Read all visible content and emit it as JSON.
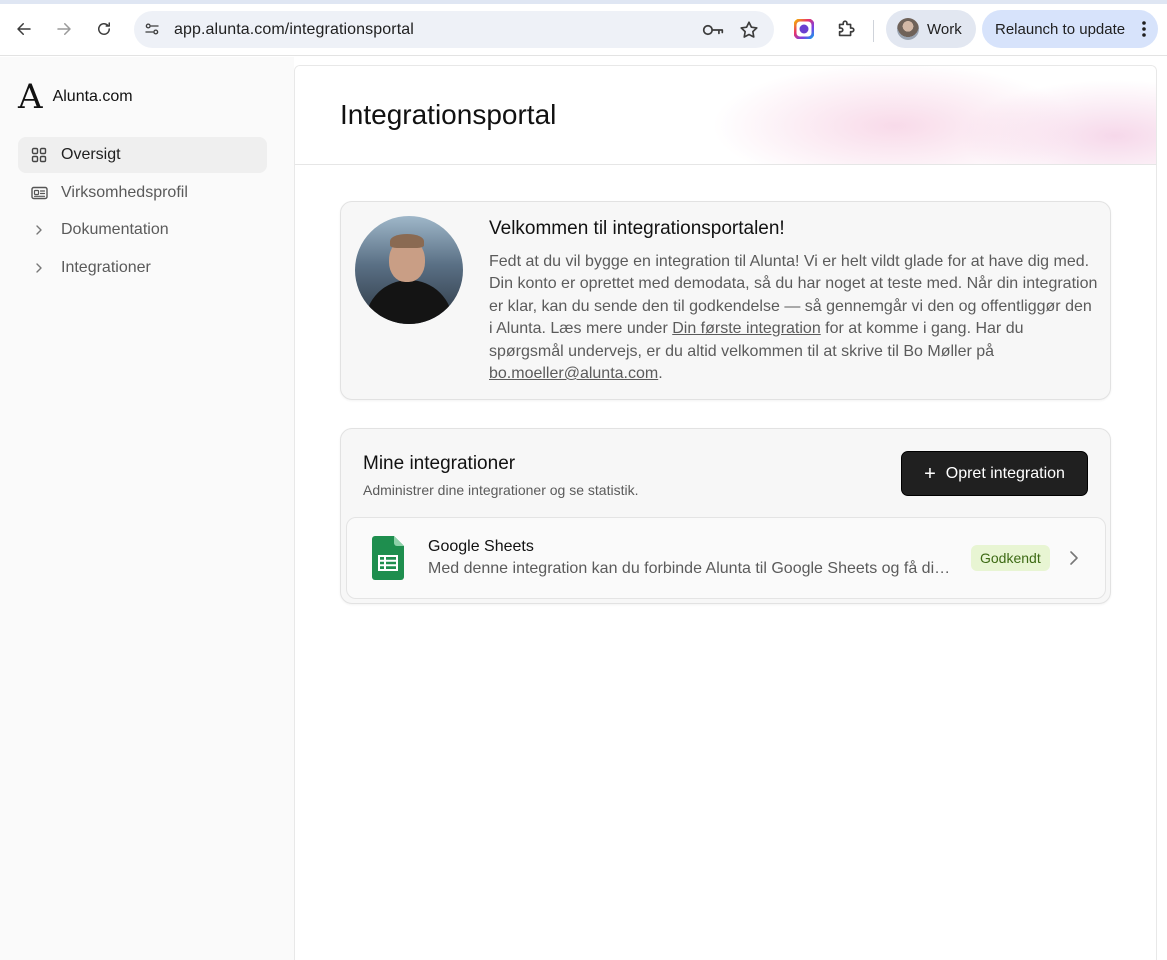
{
  "browser": {
    "url": "app.alunta.com/integrationsportal",
    "profile_label": "Work",
    "relaunch_label": "Relaunch to update"
  },
  "sidebar": {
    "brand": "Alunta.com",
    "logo_mark": "A",
    "items": [
      {
        "label": "Oversigt",
        "icon": "grid-icon",
        "active": true
      },
      {
        "label": "Virksomhedsprofil",
        "icon": "id-card-icon",
        "active": false
      },
      {
        "label": "Dokumentation",
        "icon": "chevron-right-icon",
        "active": false
      },
      {
        "label": "Integrationer",
        "icon": "chevron-right-icon",
        "active": false
      }
    ]
  },
  "main": {
    "title": "Integrationsportal",
    "welcome": {
      "title": "Velkommen til integrationsportalen!",
      "text_1": "Fedt at du vil bygge en integration til Alunta! Vi er helt vildt glade for at have dig med. Din konto er oprettet med demodata, så du har noget at teste med. Når din integration er klar, kan du sende den til godkendelse — så gennemgår vi den og offentliggør den i Alunta. Læs mere under ",
      "link_1": "Din første integration",
      "text_2": " for at komme i gang. Har du spørgsmål undervejs, er du altid velkommen til at skrive til Bo Møller på ",
      "link_2": "bo.moeller@alunta.com",
      "text_3": "."
    },
    "integrations": {
      "title": "Mine integrationer",
      "subtitle": "Administrer dine integrationer og se statistik.",
      "create_label": "Opret integration",
      "rows": [
        {
          "name": "Google Sheets",
          "description": "Med denne integration kan du forbinde Alunta til Google Sheets og få dine data direkte i regneark.",
          "status": "Godkendt",
          "icon": "google-sheets-icon"
        }
      ]
    }
  },
  "colors": {
    "accent_dark": "#202020",
    "badge_bg": "#e8f5d3",
    "badge_text": "#3d6a14",
    "sheets_green": "#1e8e4e"
  }
}
